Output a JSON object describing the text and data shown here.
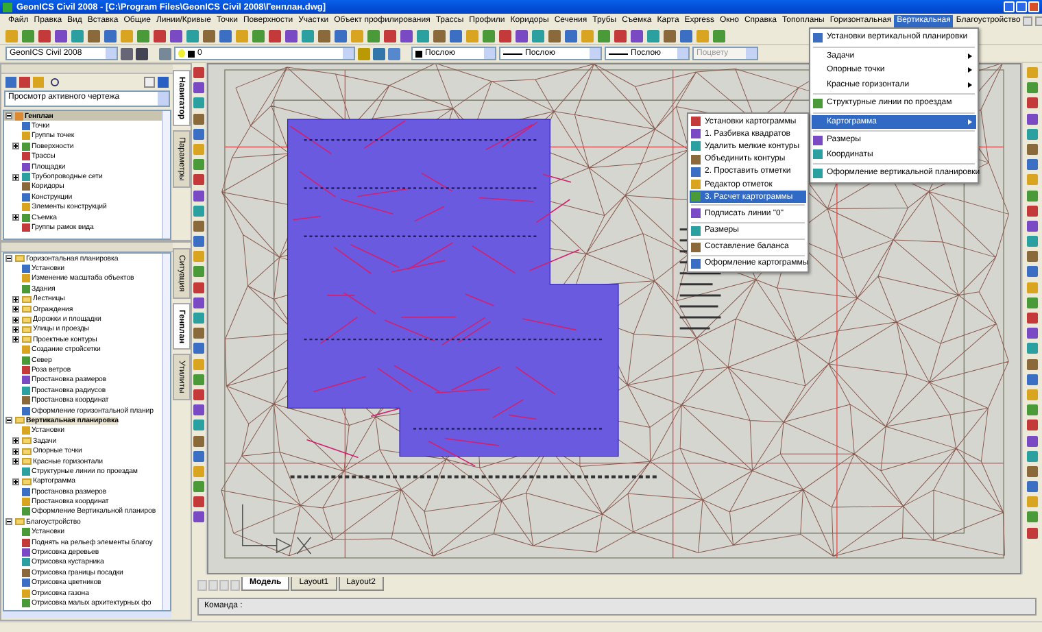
{
  "window": {
    "title": "GeonICS Civil 2008 - [C:\\Program Files\\GeonICS Civil 2008\\Генплан.dwg]"
  },
  "menu_bar": [
    {
      "label": "Файл",
      "selected": false
    },
    {
      "label": "Правка",
      "selected": false
    },
    {
      "label": "Вид",
      "selected": false
    },
    {
      "label": "Вставка",
      "selected": false
    },
    {
      "label": "Общие",
      "selected": false
    },
    {
      "label": "Линии/Кривые",
      "selected": false
    },
    {
      "label": "Точки",
      "selected": false
    },
    {
      "label": "Поверхности",
      "selected": false
    },
    {
      "label": "Участки",
      "selected": false
    },
    {
      "label": "Объект профилирования",
      "selected": false
    },
    {
      "label": "Трассы",
      "selected": false
    },
    {
      "label": "Профили",
      "selected": false
    },
    {
      "label": "Коридоры",
      "selected": false
    },
    {
      "label": "Сечения",
      "selected": false
    },
    {
      "label": "Трубы",
      "selected": false
    },
    {
      "label": "Съемка",
      "selected": false
    },
    {
      "label": "Карта",
      "selected": false
    },
    {
      "label": "Express",
      "selected": false
    },
    {
      "label": "Окно",
      "selected": false
    },
    {
      "label": "Справка",
      "selected": false
    },
    {
      "label": "Топопланы",
      "selected": false
    },
    {
      "label": "Горизонтальная",
      "selected": false
    },
    {
      "label": "Вертикальная",
      "selected": true
    },
    {
      "label": "Благоустройство",
      "selected": false
    }
  ],
  "toolbar": {
    "workspace": "GeonICS Civil 2008",
    "layer": "0",
    "object_colour": "Послою",
    "linetype": "Послою",
    "lineweight": "Послою",
    "plot_style": {
      "value": "Поцвету",
      "disabled": true
    }
  },
  "prospector": {
    "view": "Просмотр активного чертежа",
    "tabs": [
      {
        "label": "Навигатор",
        "selected": true
      },
      {
        "label": "Параметры",
        "selected": false
      }
    ],
    "tree": [
      {
        "label": "Генплан",
        "selected": true,
        "expanded": true,
        "children": [
          {
            "label": "Точки"
          },
          {
            "label": "Группы точек"
          },
          {
            "label": "Поверхности",
            "expanded": false
          },
          {
            "label": "Трассы"
          },
          {
            "label": "Площадки"
          },
          {
            "label": "Трубопроводные сети",
            "expanded": false
          },
          {
            "label": "Коридоры"
          },
          {
            "label": "Конструкции"
          },
          {
            "label": "Элементы конструкций"
          },
          {
            "label": "Съемка",
            "expanded": false
          },
          {
            "label": "Группы рамок вида"
          }
        ]
      }
    ]
  },
  "toolbox": {
    "tabs": [
      {
        "label": "Ситуация",
        "selected": false
      },
      {
        "label": "Генплан",
        "selected": true
      },
      {
        "label": "Утилиты",
        "selected": false
      }
    ],
    "tree": [
      {
        "label": "Горизонтальная планировка",
        "selected": false,
        "expanded": true,
        "children": [
          {
            "label": "Установки"
          },
          {
            "label": "Изменение масштаба объектов"
          },
          {
            "label": "Здания"
          },
          {
            "label": "Лестницы",
            "expanded": false
          },
          {
            "label": "Ограждения",
            "expanded": false
          },
          {
            "label": "Дорожки и площадки",
            "expanded": false
          },
          {
            "label": "Улицы и проезды",
            "expanded": false
          },
          {
            "label": "Проектные контуры",
            "expanded": false
          },
          {
            "label": "Создание стройсетки"
          },
          {
            "label": "Север"
          },
          {
            "label": "Роза ветров"
          },
          {
            "label": "Простановка размеров"
          },
          {
            "label": "Простановка радиусов"
          },
          {
            "label": "Простановка координат"
          },
          {
            "label": "Оформление горизонтальной планир"
          }
        ]
      },
      {
        "label": "Вертикальная планировка",
        "selected": true,
        "expanded": true,
        "children": [
          {
            "label": "Установки"
          },
          {
            "label": "Задачи",
            "expanded": false
          },
          {
            "label": "Опорные точки",
            "expanded": false
          },
          {
            "label": "Красные горизонтали",
            "expanded": false
          },
          {
            "label": "Структурные линии по проездам"
          },
          {
            "label": "Картограмма",
            "expanded": false
          },
          {
            "label": "Простановка размеров"
          },
          {
            "label": "Простановка координат"
          },
          {
            "label": "Оформление Вертикальной планиров"
          }
        ]
      },
      {
        "label": "Благоустройство",
        "selected": false,
        "expanded": true,
        "children": [
          {
            "label": "Установки"
          },
          {
            "label": "Поднять на рельеф элементы благоу"
          },
          {
            "label": "Отрисовка деревьев"
          },
          {
            "label": "Отрисовка кустарника"
          },
          {
            "label": "Отрисовка границы посадки"
          },
          {
            "label": "Отрисовка цветников"
          },
          {
            "label": "Отрисовка газона"
          },
          {
            "label": "Отрисовка малых архитектурных фо"
          }
        ]
      }
    ]
  },
  "layout_tabs": [
    {
      "label": "Модель",
      "selected": true
    },
    {
      "label": "Layout1",
      "selected": false
    },
    {
      "label": "Layout2",
      "selected": false
    }
  ],
  "command_line": {
    "prompt": "Команда :"
  },
  "vertical_menu": {
    "groups": [
      [
        {
          "label": "Установки вертикальной планировки",
          "submenu": false,
          "selected": false
        }
      ],
      [
        {
          "label": "Задачи",
          "submenu": true,
          "selected": false
        },
        {
          "label": "Опорные точки",
          "submenu": true,
          "selected": false
        },
        {
          "label": "Красные горизонтали",
          "submenu": true,
          "selected": false
        }
      ],
      [
        {
          "label": "Структурные линии по проездам",
          "submenu": false,
          "selected": false
        }
      ],
      [
        {
          "label": "Картограмма",
          "submenu": true,
          "selected": true
        }
      ],
      [
        {
          "label": "Размеры",
          "submenu": false,
          "selected": false
        },
        {
          "label": "Координаты",
          "submenu": false,
          "selected": false
        }
      ],
      [
        {
          "label": "Оформление вертикальной планировки",
          "submenu": false,
          "selected": false
        }
      ]
    ]
  },
  "cartogram_menu": {
    "groups": [
      [
        {
          "label": "Установки картограммы",
          "submenu": false,
          "selected": false
        },
        {
          "label": "1. Разбивка квадратов",
          "submenu": false,
          "selected": false
        },
        {
          "label": "Удалить мелкие контуры",
          "submenu": false,
          "selected": false
        },
        {
          "label": "Объединить контуры",
          "submenu": false,
          "selected": false
        },
        {
          "label": "2. Проставить отметки",
          "submenu": false,
          "selected": false
        },
        {
          "label": "Редактор отметок",
          "submenu": false,
          "selected": false
        },
        {
          "label": "3. Расчет картограммы",
          "submenu": false,
          "selected": true
        }
      ],
      [
        {
          "label": "Подписать линии \"0\"",
          "submenu": false,
          "selected": false
        }
      ],
      [
        {
          "label": "Размеры",
          "submenu": false,
          "selected": false
        }
      ],
      [
        {
          "label": "Составление баланса",
          "submenu": false,
          "selected": false
        }
      ],
      [
        {
          "label": "Оформление картограммы",
          "submenu": false,
          "selected": false
        }
      ]
    ]
  }
}
